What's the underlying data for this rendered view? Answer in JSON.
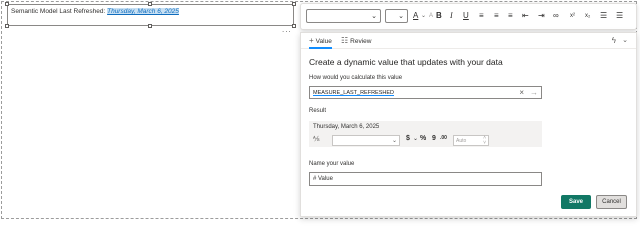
{
  "textbox": {
    "prefix": "Semantic Model Last Refreshed: ",
    "value": "Thursday, March 6, 2025",
    "more": "..."
  },
  "toolbar": {
    "icons": [
      "font-family-select",
      "font-size-select",
      "font-color-icon",
      "decrease-font-icon",
      "bold-icon",
      "italic-icon",
      "underline-icon",
      "align-left-icon",
      "align-center-icon",
      "align-right-icon",
      "outdent-icon",
      "indent-icon",
      "link-icon",
      "superscript-icon",
      "subscript-icon",
      "bullet-list-icon",
      "numbered-list-icon"
    ],
    "font_color_glyph": "A",
    "bold_glyph": "B",
    "italic_glyph": "I",
    "underline_glyph": "U",
    "superscript_glyph": "x²",
    "subscript_glyph": "x₂"
  },
  "panel": {
    "tabs": [
      {
        "label": "Value",
        "icon": "plus-icon",
        "active": true
      },
      {
        "label": "Review",
        "icon": "table-icon",
        "active": false
      }
    ],
    "heading": "Create a dynamic value that updates with your data",
    "calc_label": "How would you calculate this value",
    "measure_value": "MEASURE_LAST_REFRESHED",
    "result_label": "Result",
    "result_value": "Thursday, March 6, 2025",
    "format": {
      "currency_symbol": "$",
      "percent_symbol": "%",
      "comma_symbol": "9",
      "decimal_symbol": ".00",
      "decimals_placeholder": "Auto"
    },
    "name_label": "Name your value",
    "name_value": "# Value",
    "save_label": "Save",
    "cancel_label": "Cancel"
  },
  "colors": {
    "accent": "#118dff",
    "save_button": "#117865",
    "selection": "#c7e0f4"
  }
}
